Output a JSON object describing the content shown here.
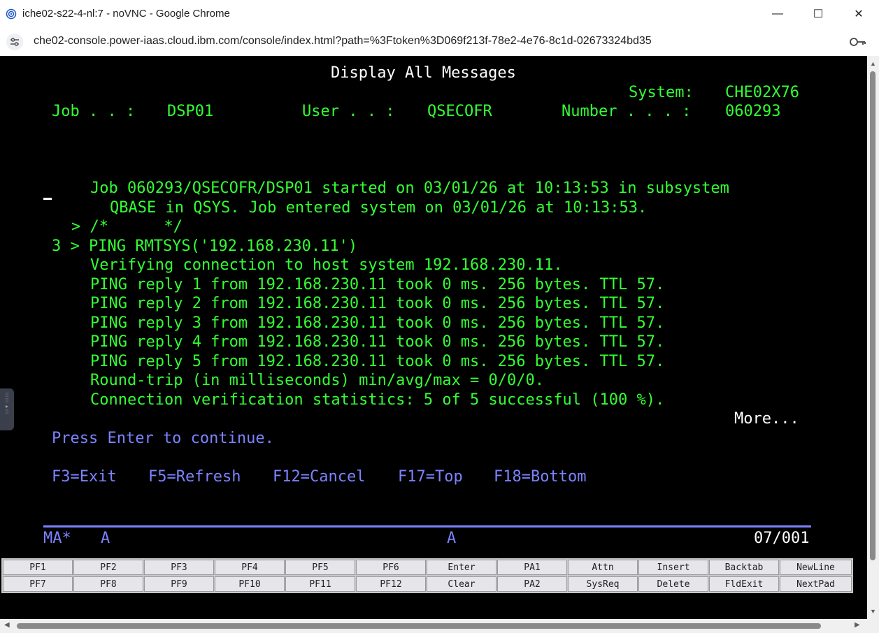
{
  "window": {
    "title": "iche02-s22-4-nl:7 - noVNC - Google Chrome",
    "url": "che02-console.power-iaas.cloud.ibm.com/console/index.html?path=%3Ftoken%3D069f213f-78e2-4e76-8c1d-02673324bd35",
    "controls": {
      "minimize": "—",
      "maximize": "☐",
      "close": "✕"
    }
  },
  "screen": {
    "title": "Display All Messages",
    "system_label": "System:",
    "system_value": "CHE02X76",
    "job_label": "Job . . :",
    "job_value": "DSP01",
    "user_label": "User . . :",
    "user_value": "QSECOFR",
    "number_label": "Number . . . :",
    "number_value": "060293",
    "messages": [
      "Job 060293/QSECOFR/DSP01 started on 03/01/26 at 10:13:53 in subsystem",
      "QBASE in QSYS. Job entered system on 03/01/26 at 10:13:53.",
      "> /*      */",
      "3 > PING RMTSYS('192.168.230.11')",
      "Verifying connection to host system 192.168.230.11.",
      "PING reply 1 from 192.168.230.11 took 0 ms. 256 bytes. TTL 57.",
      "PING reply 2 from 192.168.230.11 took 0 ms. 256 bytes. TTL 57.",
      "PING reply 3 from 192.168.230.11 took 0 ms. 256 bytes. TTL 57.",
      "PING reply 4 from 192.168.230.11 took 0 ms. 256 bytes. TTL 57.",
      "PING reply 5 from 192.168.230.11 took 0 ms. 256 bytes. TTL 57.",
      "Round-trip (in milliseconds) min/avg/max = 0/0/0.",
      "Connection verification statistics: 5 of 5 successful (100 %)."
    ],
    "more": "More...",
    "press_enter": "Press Enter to continue.",
    "fkeys": {
      "f3": "F3=Exit",
      "f5": "F5=Refresh",
      "f12": "F12=Cancel",
      "f17": "F17=Top",
      "f18": "F18=Bottom"
    },
    "status": {
      "mode": "MA*",
      "a1": "A",
      "a2": "A",
      "cursor_pos": "07/001"
    }
  },
  "keypad": {
    "row1": [
      "PF1",
      "PF2",
      "PF3",
      "PF4",
      "PF5",
      "PF6",
      "Enter",
      "PA1",
      "Attn",
      "Insert",
      "Backtab",
      "NewLine"
    ],
    "row2": [
      "PF7",
      "PF8",
      "PF9",
      "PF10",
      "PF11",
      "PF12",
      "Clear",
      "PA2",
      "SysReq",
      "Delete",
      "FldExit",
      "NextPad"
    ]
  },
  "colors": {
    "terminal_bg": "#000000",
    "green_text": "#33ff33",
    "blue_text": "#7b83ff",
    "white_text": "#ffffff"
  }
}
